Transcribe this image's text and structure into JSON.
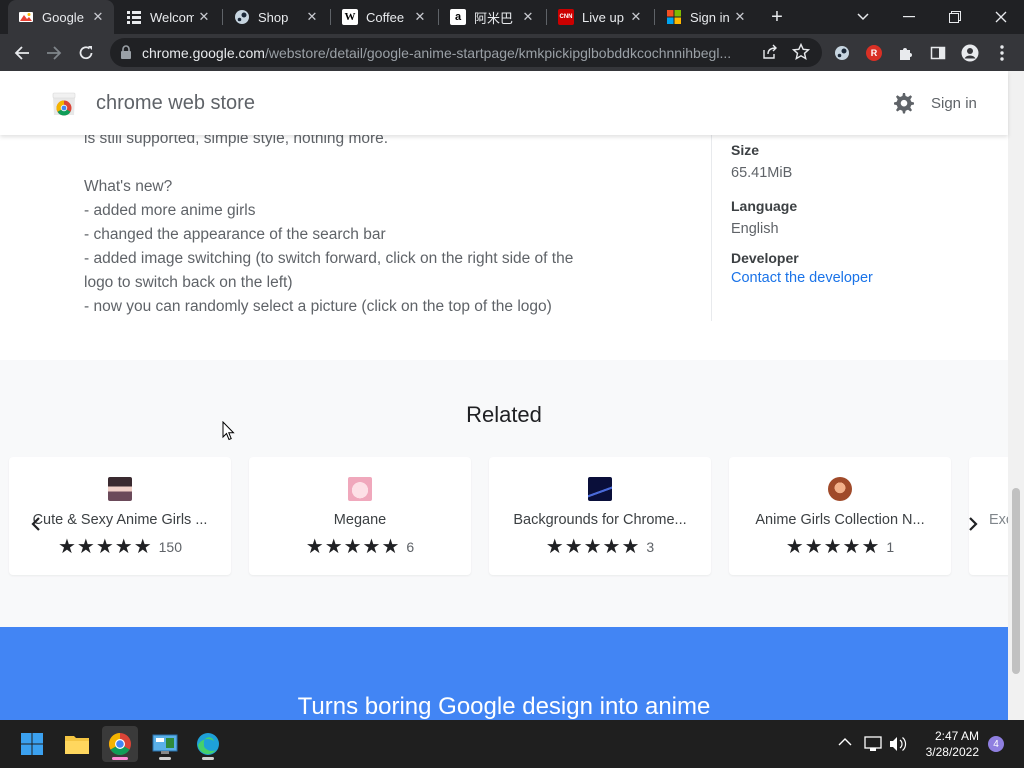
{
  "browser": {
    "tabs": [
      {
        "label": "Google",
        "favicon": "google-doodle-icon",
        "active": true
      },
      {
        "label": "Welcom",
        "favicon": "grid-icon"
      },
      {
        "label": "Shop",
        "favicon": "steam-icon"
      },
      {
        "label": "Coffee",
        "favicon": "wikipedia-icon"
      },
      {
        "label": "阿米巴",
        "favicon": "amazon-icon"
      },
      {
        "label": "Live up",
        "favicon": "cnn-icon"
      },
      {
        "label": "Sign in",
        "favicon": "microsoft-icon"
      }
    ],
    "favicon_text": {
      "wikipedia": "W",
      "amazon": "a",
      "cnn": "CNN"
    },
    "url_host": "chrome.google.com",
    "url_path": "/webstore/detail/google-anime-startpage/kmkpickipglbobddkcochnnihbegl...",
    "extension_badge": "R"
  },
  "store": {
    "name": "chrome web store",
    "signin": "Sign in"
  },
  "description": {
    "partial_line": "is still supported, simple style, nothing more.",
    "whats_new": "What's new?",
    "items": [
      "- added more anime girls",
      "- changed the appearance of the search bar",
      "- added image switching (to switch forward, click on the right side of the",
      "logo to switch back on the left)",
      "- now you can randomly select a picture (click on the top of the logo)"
    ]
  },
  "meta": {
    "size_label": "Size",
    "size_value": "65.41MiB",
    "language_label": "Language",
    "language_value": "English",
    "developer_label": "Developer",
    "developer_link": "Contact the developer"
  },
  "related": {
    "title": "Related",
    "cards": [
      {
        "title": "Cute & Sexy Anime Girls ...",
        "rating": 5,
        "count": "150",
        "thumb_color": "#6b4a5a"
      },
      {
        "title": "Megane",
        "rating": 5,
        "count": "6",
        "thumb_color": "#f0b8c8"
      },
      {
        "title": "Backgrounds for Chrome...",
        "rating": 5,
        "count": "3",
        "thumb_color": "#1b2a6e"
      },
      {
        "title": "Anime Girls Collection N...",
        "rating": 5,
        "count": "1",
        "thumb_color": "#a04a2a"
      },
      {
        "title": "Exc",
        "rating": 5,
        "count": "",
        "thumb_color": "#cccccc"
      }
    ],
    "stars": "★★★★★"
  },
  "banner": {
    "title": "Turns boring Google design into anime"
  },
  "taskbar": {
    "apps": [
      "windows-start-icon",
      "file-explorer-icon",
      "chrome-icon",
      "control-panel-icon",
      "edge-icon"
    ],
    "time": "2:47 AM",
    "date": "3/28/2022",
    "notifications": "4"
  },
  "colors": {
    "link": "#1a73e8",
    "banner": "#4285f4",
    "chrome_dark": "#202124"
  }
}
